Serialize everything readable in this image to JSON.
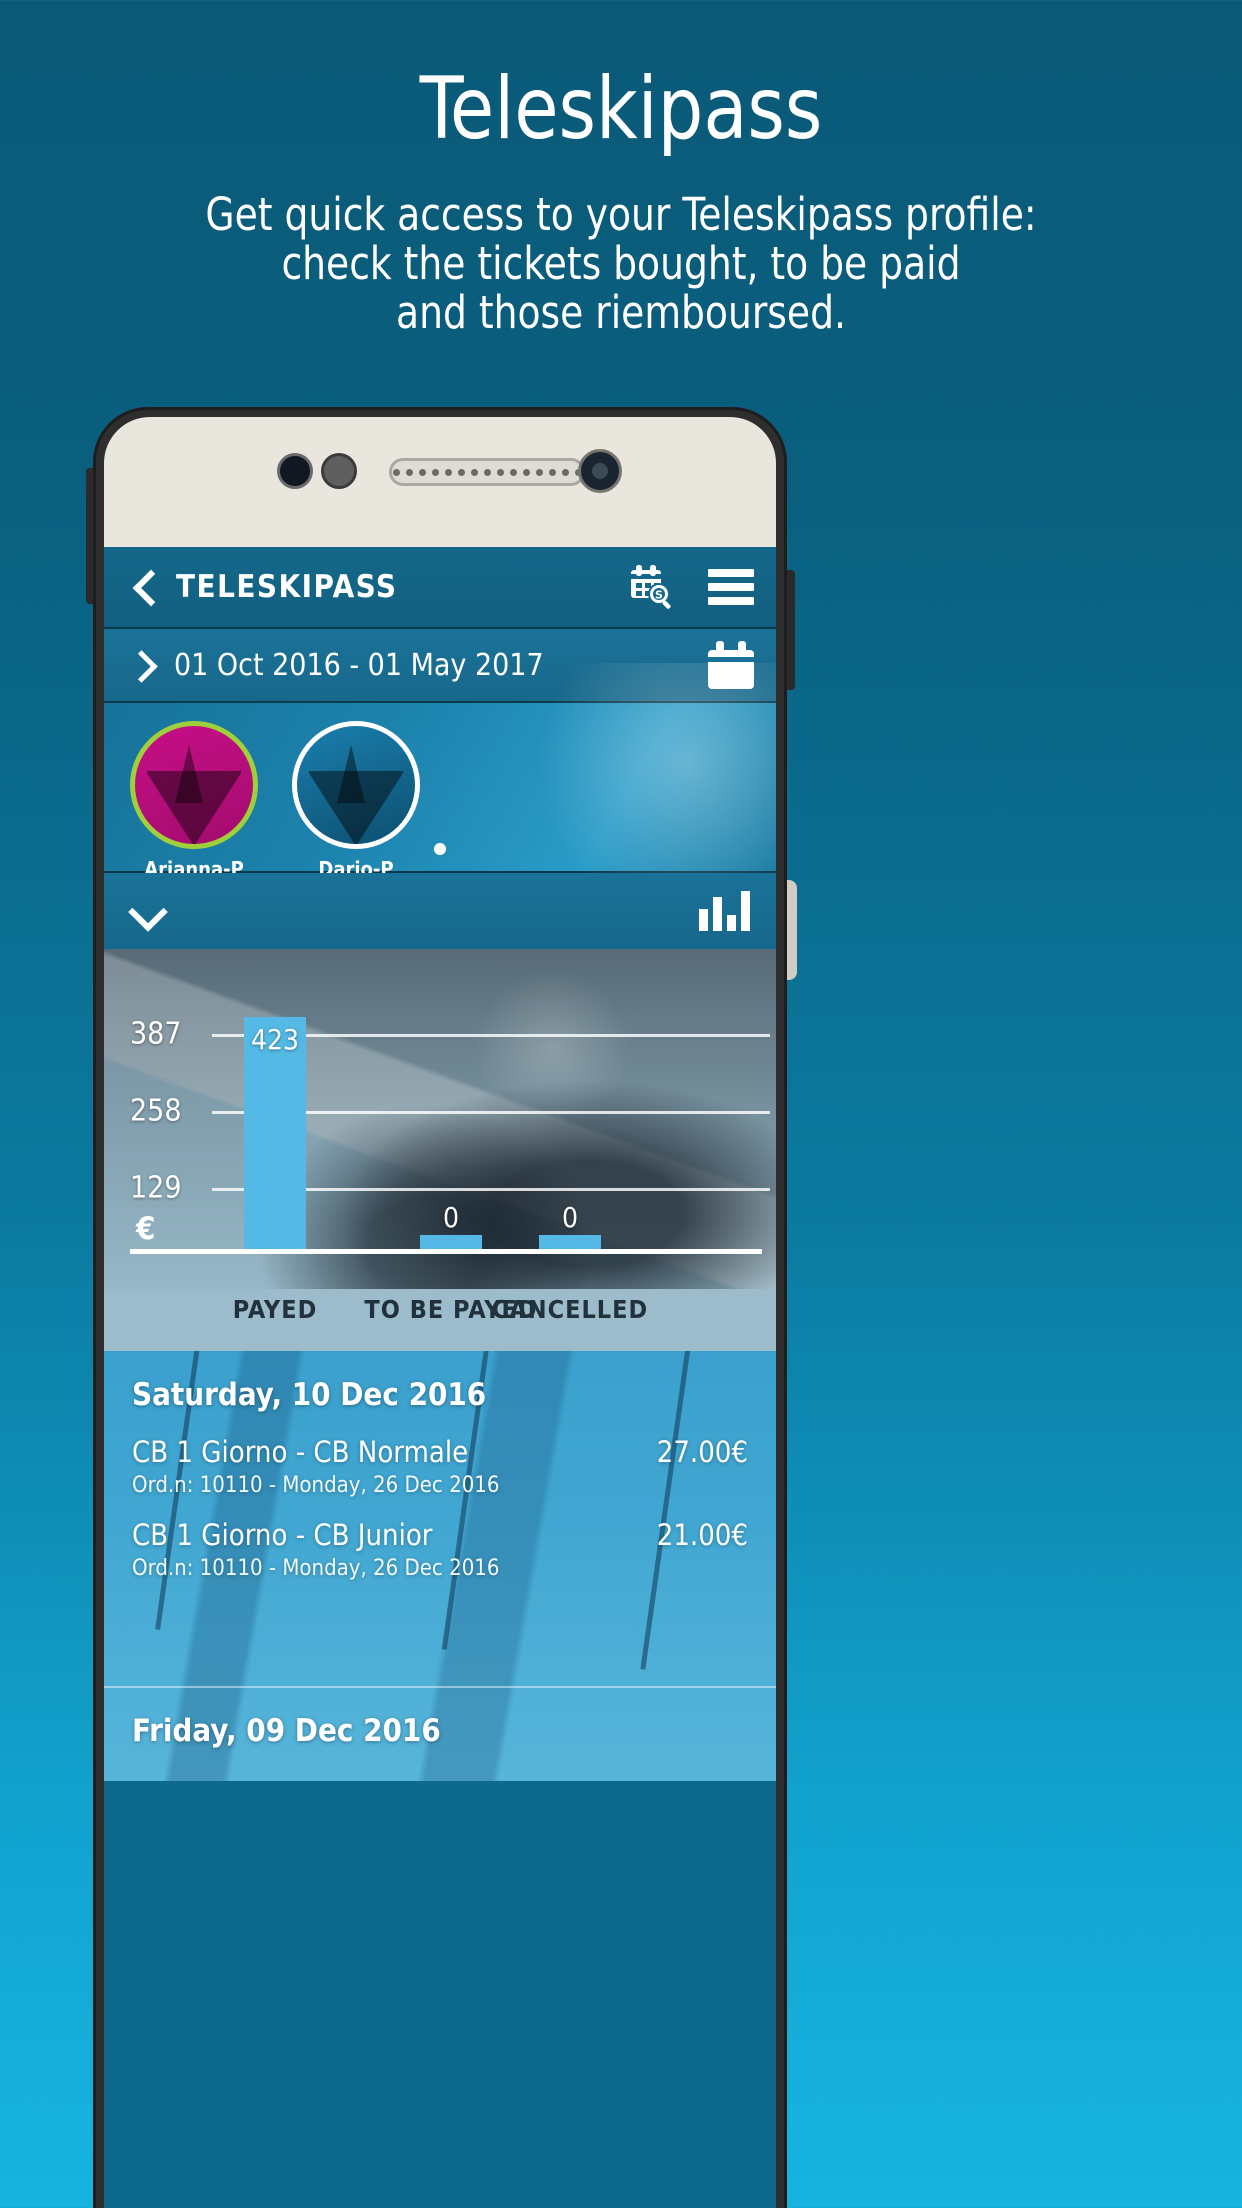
{
  "promo": {
    "title": "Teleskipass",
    "subtitle_lines": [
      "Get quick access to your Teleskipass profile:",
      "check the tickets bought, to be paid",
      "and those riemboursed."
    ]
  },
  "app": {
    "appbar": {
      "back_icon": "chevron-left-icon",
      "title": "TELESKIPASS",
      "calendar_search_icon": "calendar-search-icon",
      "menu_icon": "hamburger-menu-icon"
    },
    "date_row": {
      "expand_icon": "chevron-right-icon",
      "range": "01 Oct 2016 - 01 May 2017",
      "calendar_icon": "calendar-icon"
    },
    "profiles": [
      {
        "name": "Arianna-P",
        "ring_color": "#9fcf3a",
        "selected": true
      },
      {
        "name": "Dario-P",
        "ring_color": "#ffffff",
        "selected": false
      }
    ],
    "pager": {
      "dots": 1,
      "active": 0
    },
    "chart_header": {
      "collapse_icon": "chevron-down-icon",
      "chart_icon": "bar-chart-icon"
    },
    "transactions": {
      "groups": [
        {
          "day_label": "Saturday, 10 Dec 2016",
          "items": [
            {
              "name": "CB 1 Giorno - CB Normale",
              "amount": "27.00€",
              "order": "Ord.n: 10110 - Monday, 26 Dec 2016"
            },
            {
              "name": "CB 1 Giorno - CB Junior",
              "amount": "21.00€",
              "order": "Ord.n: 10110 - Monday, 26 Dec 2016"
            }
          ]
        },
        {
          "day_label": "Friday, 09 Dec 2016",
          "items": []
        }
      ]
    }
  },
  "chart_data": {
    "type": "bar",
    "title": "",
    "categories": [
      "PAYED",
      "TO BE PAYED",
      "CANCELLED"
    ],
    "values": [
      423,
      0,
      0
    ],
    "data_labels": [
      "423",
      "0",
      "0"
    ],
    "ytick_labels": [
      "387",
      "258",
      "129"
    ],
    "ytick_values": [
      387,
      258,
      129
    ],
    "ylabel": "€",
    "xlabel": "",
    "ylim": [
      0,
      516
    ],
    "grid": true,
    "legend": "none",
    "bar_color": "#54b9e4"
  }
}
